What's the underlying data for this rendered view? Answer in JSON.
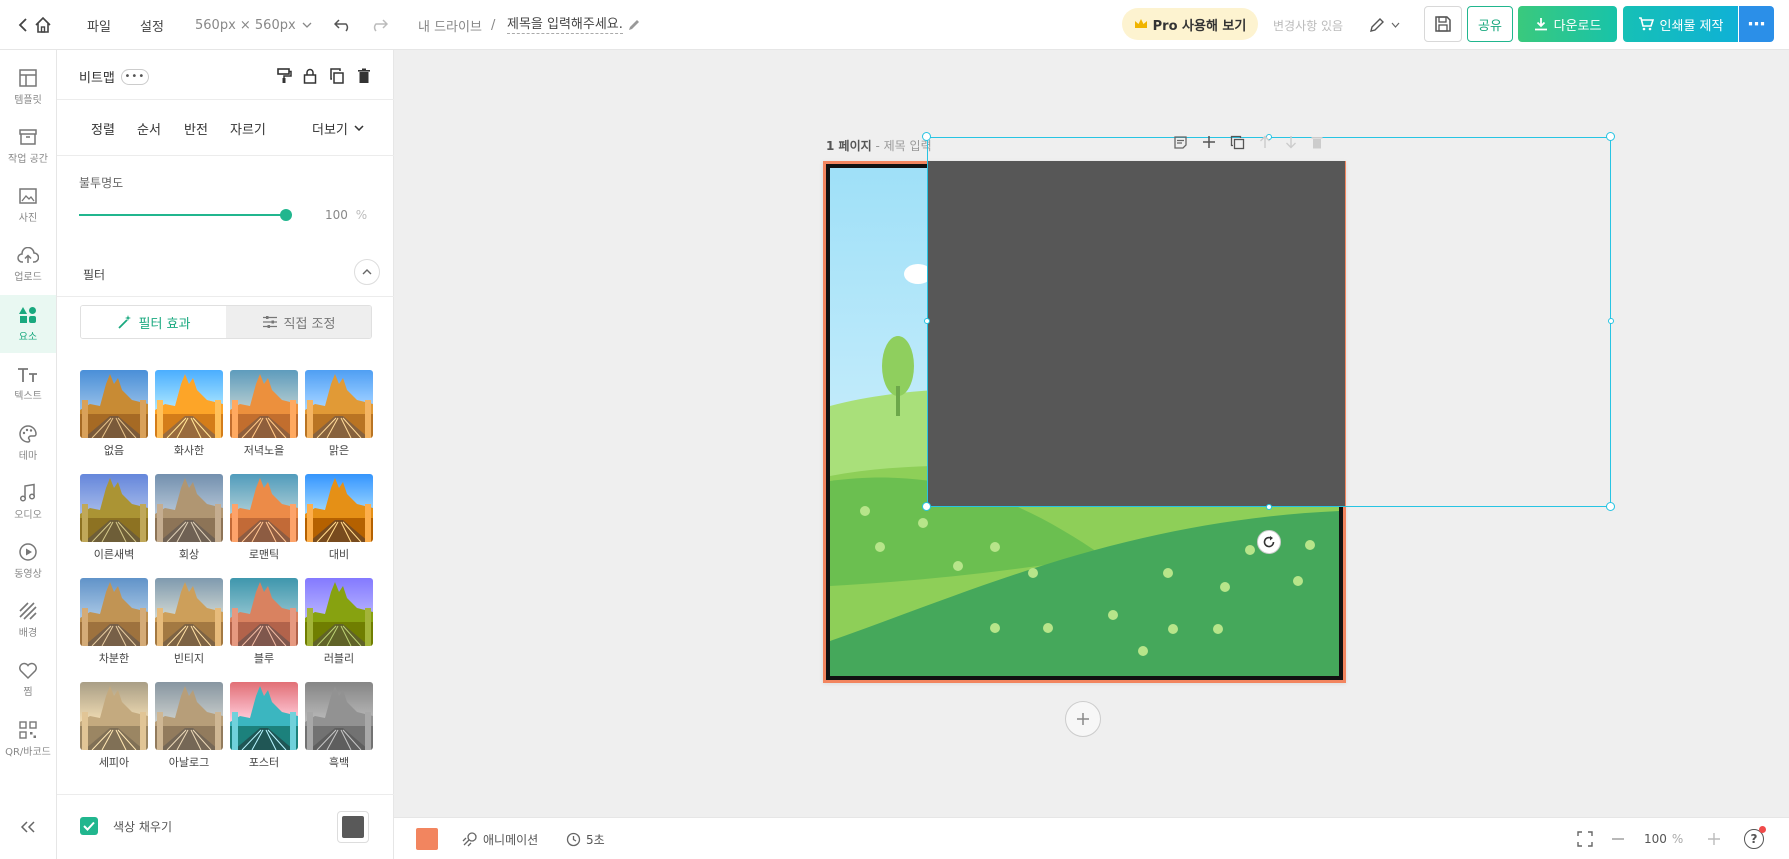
{
  "topbar": {
    "menu_file": "파일",
    "menu_settings": "설정",
    "canvas_size": "560px × 560px",
    "breadcrumb_root": "내 드라이브",
    "breadcrumb_sep": "/",
    "doc_title": "제목을 입력해주세요.",
    "pro_label": "Pro 사용해 보기",
    "save_status": "변경사항 있음",
    "share_label": "공유",
    "download_label": "다운로드",
    "print_label": "인쇄물 제작",
    "more_label": "⋯"
  },
  "rail": {
    "items": [
      {
        "label": "템플릿",
        "icon": "template-icon"
      },
      {
        "label": "작업 공간",
        "icon": "workspace-icon"
      },
      {
        "label": "사진",
        "icon": "photo-icon"
      },
      {
        "label": "업로드",
        "icon": "upload-icon"
      },
      {
        "label": "요소",
        "icon": "elements-icon"
      },
      {
        "label": "텍스트",
        "icon": "text-icon"
      },
      {
        "label": "테마",
        "icon": "theme-icon"
      },
      {
        "label": "오디오",
        "icon": "audio-icon"
      },
      {
        "label": "동영상",
        "icon": "video-icon"
      },
      {
        "label": "배경",
        "icon": "background-icon"
      },
      {
        "label": "찜",
        "icon": "heart-icon"
      },
      {
        "label": "QR/바코드",
        "icon": "qr-icon"
      }
    ],
    "active_index": 4
  },
  "panel": {
    "element_type": "비트맵",
    "tabs": [
      "정렬",
      "순서",
      "반전",
      "자르기"
    ],
    "more_label": "더보기",
    "opacity_label": "불투명도",
    "opacity_value": "100",
    "opacity_unit": "%",
    "filter_section": "필터",
    "filter_tab_effect": "필터 효과",
    "filter_tab_manual": "직접 조정",
    "filters": [
      {
        "label": "없음",
        "tint": "none"
      },
      {
        "label": "화사한",
        "tint": "bright"
      },
      {
        "label": "저녁노을",
        "tint": "sunset"
      },
      {
        "label": "맑은",
        "tint": "clear"
      },
      {
        "label": "이른새벽",
        "tint": "dawn"
      },
      {
        "label": "회상",
        "tint": "memory"
      },
      {
        "label": "로맨틱",
        "tint": "romantic"
      },
      {
        "label": "대비",
        "tint": "contrast"
      },
      {
        "label": "차분한",
        "tint": "calm"
      },
      {
        "label": "빈티지",
        "tint": "vintage"
      },
      {
        "label": "블루",
        "tint": "blue"
      },
      {
        "label": "러블리",
        "tint": "lovely"
      },
      {
        "label": "세피아",
        "tint": "sepia"
      },
      {
        "label": "아날로그",
        "tint": "analog"
      },
      {
        "label": "포스터",
        "tint": "poster"
      },
      {
        "label": "흑백",
        "tint": "grayscale"
      }
    ],
    "fill_color_label": "색상 채우기",
    "fill_color": "#595959"
  },
  "canvas": {
    "page_number": "1 페이지",
    "page_title_placeholder": "- 제목 입력",
    "shape_color": "#575757",
    "frame_color": "#f2855f",
    "selection_color": "#27c4e3"
  },
  "bottombar": {
    "bg_color": "#f2855f",
    "animation_label": "애니메이션",
    "duration_label": "5초",
    "zoom_value": "100",
    "zoom_unit": "%",
    "help_label": "?"
  },
  "colors": {
    "accent": "#21b68e",
    "download_gradient_start": "#3ac97d",
    "print_gradient_start": "#16c0b6",
    "more_button": "#2b8fe8",
    "pro_bg": "#fdf3d0"
  }
}
